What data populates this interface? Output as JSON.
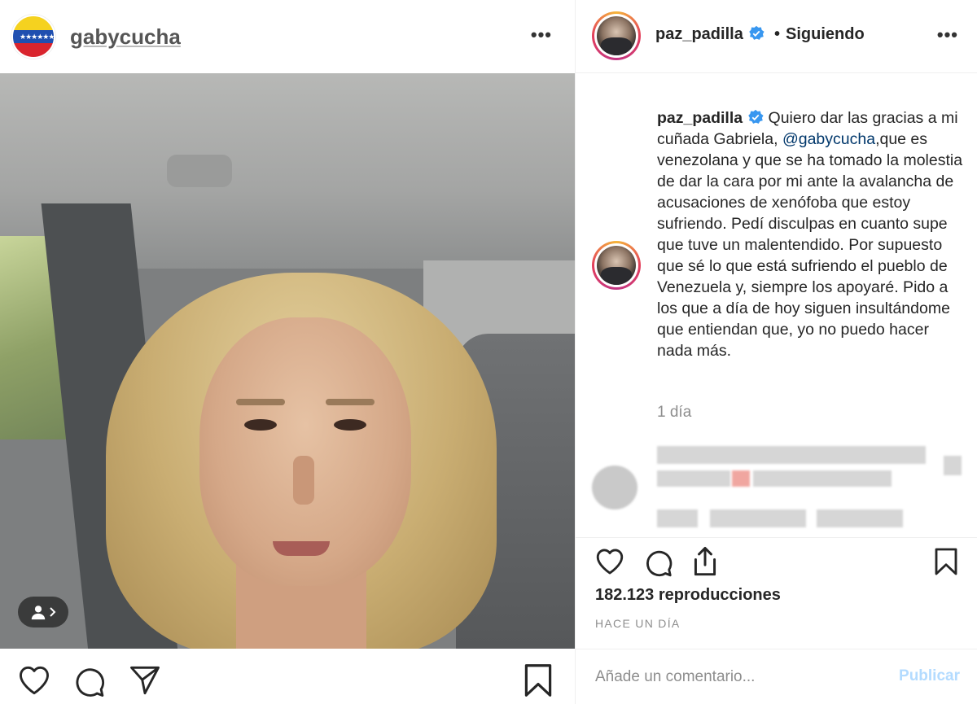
{
  "left_post": {
    "username": "gabycucha",
    "more_icon": "more-horizontal-icon",
    "video_overlay_icon": "tagged-user-icon",
    "actions": [
      "heart-icon",
      "comment-icon",
      "send-icon",
      "bookmark-icon"
    ]
  },
  "right_post": {
    "header": {
      "username": "paz_padilla",
      "verified_icon": "verified-badge-icon",
      "separator": "•",
      "follow_status": "Siguiendo",
      "more_icon": "more-horizontal-icon"
    },
    "caption": {
      "username": "paz_padilla",
      "text_before_mention": "Quiero dar las gracias a mi cuñada Gabriela, ",
      "mention": "@gabycucha",
      "text_after_mention": ",que es venezolana y que se ha tomado la molestia de dar la cara por mi ante la avalancha de acusaciones de xenófoba que estoy sufriendo. Pedí disculpas en cuanto supe que tuve un malentendido. Por supuesto que sé lo que está sufriendo el pueblo de Venezuela y, siempre los apoyaré. Pido a los que a día de hoy siguen insultándome que entiendan que, yo no puedo hacer nada más."
    },
    "caption_time": "1 día",
    "actions": [
      "heart-icon",
      "comment-icon",
      "share-icon",
      "bookmark-icon"
    ],
    "views": "182.123 reproducciones",
    "posted_ago": "HACE UN DÍA",
    "comment": {
      "placeholder": "Añade un comentario...",
      "publish_label": "Publicar"
    }
  },
  "colors": {
    "text": "#262626",
    "secondary": "#8e8e8e",
    "mention": "#00376b",
    "verified": "#3897f0",
    "publish_disabled": "#b3dbff",
    "border": "#efefef"
  }
}
